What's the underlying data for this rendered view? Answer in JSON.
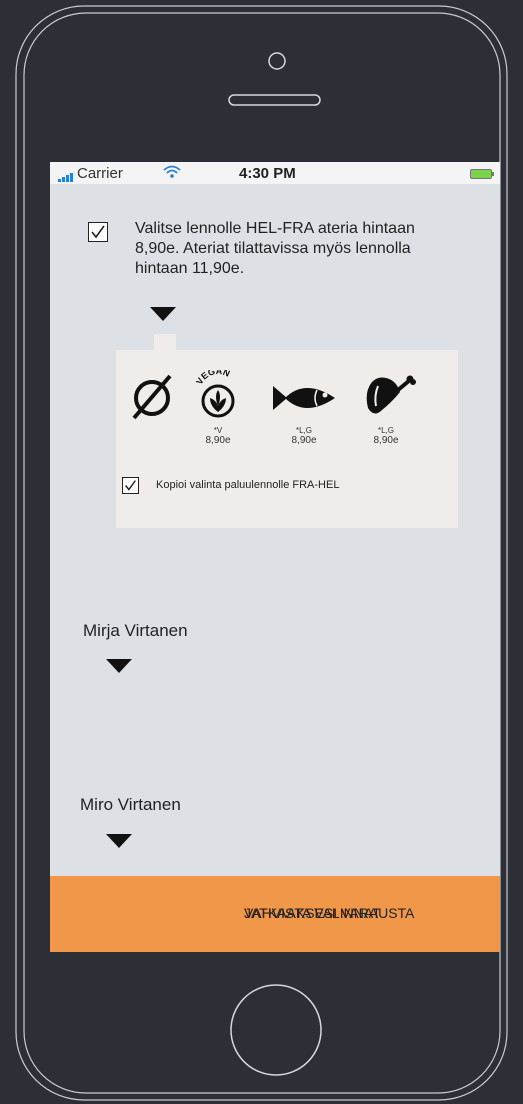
{
  "status_bar": {
    "carrier": "Carrier",
    "time": "4:30 PM"
  },
  "meal_offer": {
    "checked": true,
    "text": "Valitse lennolle HEL-FRA ateria hintaan 8,90e. Ateriat tilattavissa myös lennolla hintaan 11,90e."
  },
  "meal_options": [
    {
      "icon": "no-meal-icon",
      "diet": "",
      "price": ""
    },
    {
      "icon": "vegan-meal-icon",
      "badge": "VEGAN",
      "diet": "*V",
      "price": "8,90e"
    },
    {
      "icon": "fish-meal-icon",
      "diet": "*L,G",
      "price": "8,90e"
    },
    {
      "icon": "ham-meal-icon",
      "diet": "*L,G",
      "price": "8,90e"
    }
  ],
  "copy_return": {
    "checked": true,
    "label": "Kopioi valinta paluulennolle FRA-HEL"
  },
  "passengers": [
    {
      "name": "Mirja Virtanen"
    },
    {
      "name": "Miro Virtanen"
    }
  ],
  "confirm_button": {
    "line1": "VAHVISTA VALINNAT",
    "line2": "JATKAAKSESI VARAUSTA",
    "color": "#f0974a"
  },
  "colors": {
    "background": "#2d2f37",
    "screen": "#dde1e6",
    "panel": "#f0ecea"
  }
}
